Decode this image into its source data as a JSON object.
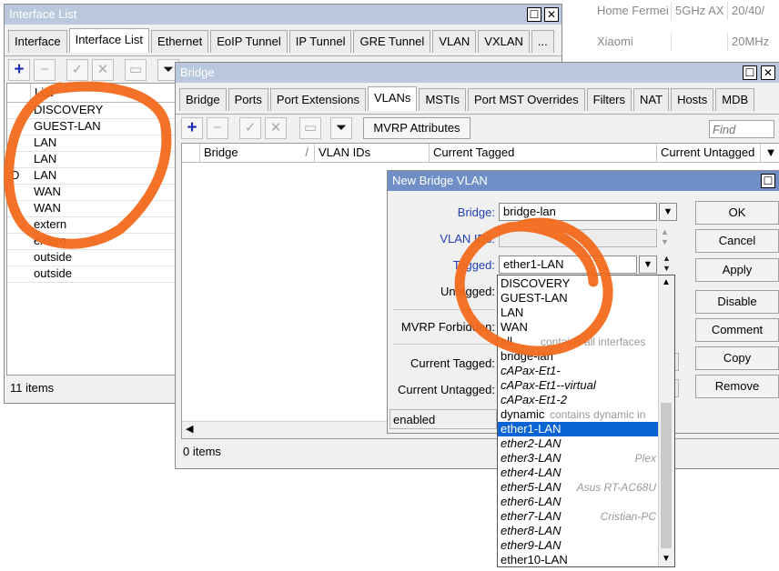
{
  "bg_table": {
    "rows": [
      {
        "name": "Home Fermei",
        "band": "5GHz AX",
        "chan": "20/40/"
      },
      {
        "name": "Xiaomi",
        "band": "",
        "chan": "20MHz"
      }
    ]
  },
  "interface_list_window": {
    "title": "Interface List",
    "close_glyph": "✕",
    "tabs": [
      "Interface",
      "Interface List",
      "Ethernet",
      "EoIP Tunnel",
      "IP Tunnel",
      "GRE Tunnel",
      "VLAN",
      "VXLAN",
      "..."
    ],
    "active_tab": 1,
    "column_header": "List",
    "rows": [
      {
        "flag": "",
        "list": "DISCOVERY"
      },
      {
        "flag": "",
        "list": "GUEST-LAN"
      },
      {
        "flag": "",
        "list": "LAN"
      },
      {
        "flag": "",
        "list": "LAN"
      },
      {
        "flag": "D",
        "list": "LAN"
      },
      {
        "flag": "",
        "list": "WAN"
      },
      {
        "flag": "",
        "list": "WAN"
      },
      {
        "flag": "",
        "list": "extern"
      },
      {
        "flag": "",
        "list": "extern"
      },
      {
        "flag": "",
        "list": "outside"
      },
      {
        "flag": "",
        "list": "outside"
      }
    ],
    "status": "11 items"
  },
  "bridge_window": {
    "title": "Bridge",
    "tabs": [
      "Bridge",
      "Ports",
      "Port Extensions",
      "VLANs",
      "MSTIs",
      "Port MST Overrides",
      "Filters",
      "NAT",
      "Hosts",
      "MDB"
    ],
    "active_tab": 3,
    "mvrp_button": "MVRP Attributes",
    "find_placeholder": "Find",
    "columns": [
      "Bridge",
      "VLAN IDs",
      "Current Tagged",
      "Current Untagged"
    ],
    "status": "0 items"
  },
  "new_vlan_dialog": {
    "title": "New Bridge VLAN",
    "labels": {
      "bridge": "Bridge:",
      "vlan_ids": "VLAN IDs:",
      "tagged": "Tagged:",
      "untagged": "Untagged:",
      "mvrp_forbidden": "MVRP Forbidden:",
      "current_tagged": "Current Tagged:",
      "current_untagged": "Current Untagged:"
    },
    "bridge_value": "bridge-lan",
    "vlan_ids_value": "",
    "tagged_value": "ether1-LAN",
    "status": "enabled",
    "buttons": [
      "OK",
      "Cancel",
      "Apply",
      "Disable",
      "Comment",
      "Copy",
      "Remove"
    ]
  },
  "dropdown": {
    "items": [
      {
        "text": "DISCOVERY",
        "style": "normal",
        "comment": ""
      },
      {
        "text": "GUEST-LAN",
        "style": "normal",
        "comment": ""
      },
      {
        "text": "LAN",
        "style": "normal",
        "comment": ""
      },
      {
        "text": "WAN",
        "style": "normal",
        "comment": ""
      },
      {
        "text": "all",
        "style": "normal",
        "comment": "contains all interfaces"
      },
      {
        "text": "bridge-lan",
        "style": "normal",
        "comment": ""
      },
      {
        "text": "cAPax-Et1-",
        "style": "italic",
        "comment": ""
      },
      {
        "text": "cAPax-Et1--virtual",
        "style": "italic",
        "comment": ""
      },
      {
        "text": "cAPax-Et1-2",
        "style": "italic",
        "comment": ""
      },
      {
        "text": "dynamic",
        "style": "normal",
        "comment": "contains dynamic in"
      },
      {
        "text": "ether1-LAN",
        "style": "selected",
        "comment": ""
      },
      {
        "text": "ether2-LAN",
        "style": "italic",
        "comment": ""
      },
      {
        "text": "ether3-LAN",
        "style": "italic",
        "comment": "Plex"
      },
      {
        "text": "ether4-LAN",
        "style": "italic",
        "comment": ""
      },
      {
        "text": "ether5-LAN",
        "style": "italic",
        "comment": "Asus RT-AC68U"
      },
      {
        "text": "ether6-LAN",
        "style": "italic",
        "comment": ""
      },
      {
        "text": "ether7-LAN",
        "style": "italic",
        "comment": "Cristian-PC"
      },
      {
        "text": "ether8-LAN",
        "style": "italic",
        "comment": ""
      },
      {
        "text": "ether9-LAN",
        "style": "italic",
        "comment": ""
      },
      {
        "text": "ether10-LAN",
        "style": "normal",
        "comment": ""
      }
    ]
  },
  "colors": {
    "inactive_title": "#b9c8dc",
    "active_title": "#6f8fc6",
    "annotation": "#f26a1b",
    "selection": "#0a64d4",
    "label_blue": "#1f3fb5"
  }
}
